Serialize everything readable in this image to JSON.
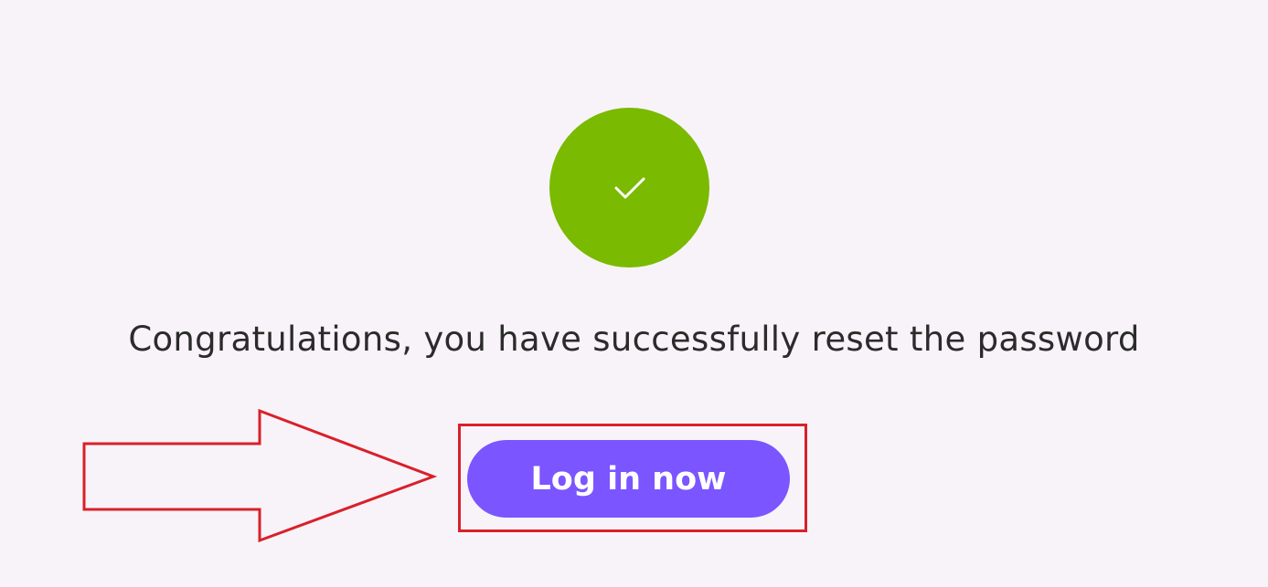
{
  "success": {
    "icon": "check-icon",
    "circle_color": "#7aba00"
  },
  "message": {
    "text": "Congratulations, you have successfully reset the password"
  },
  "login_button": {
    "label": "Log in now",
    "color": "#7b55ff"
  },
  "annotation": {
    "arrow_icon": "arrow-right-icon",
    "highlight_color": "#d9202a"
  }
}
